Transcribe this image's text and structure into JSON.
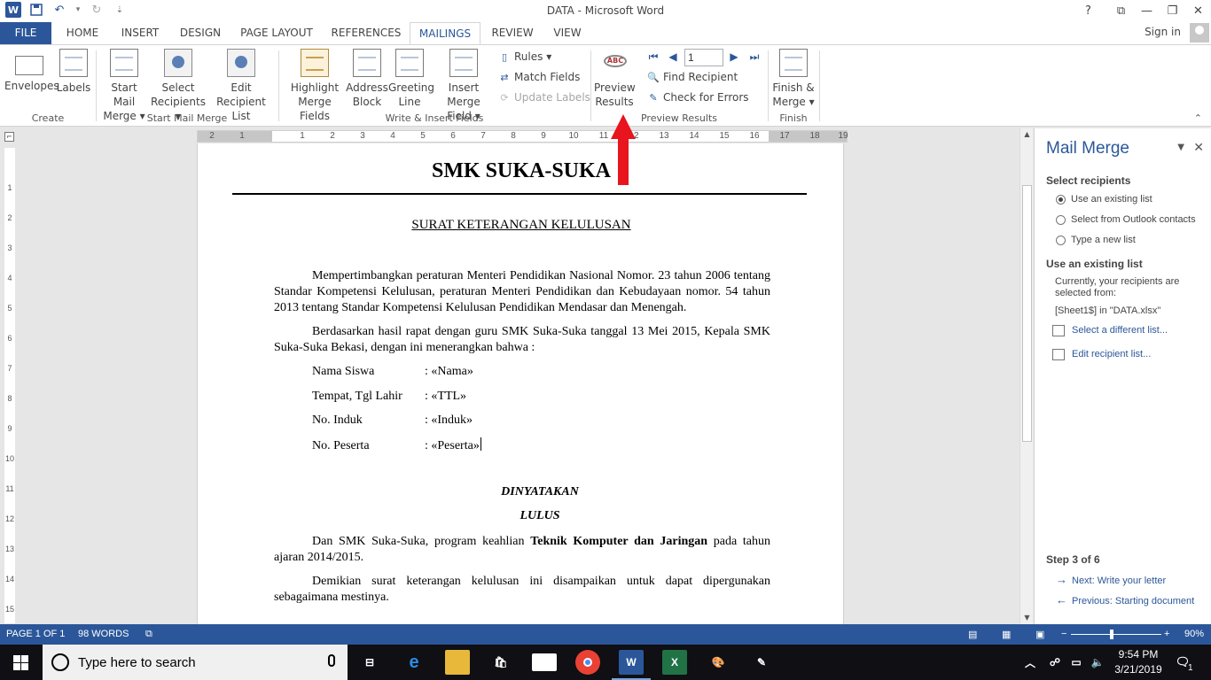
{
  "window": {
    "title": "DATA - Microsoft Word",
    "help": "?",
    "ribbon_opts": "⧉",
    "minimize": "—",
    "restore": "❐",
    "close": "✕"
  },
  "qat": {
    "app_icon": "W",
    "save_icon": "💾",
    "undo": "↶",
    "undo_drop": "▾",
    "redo": "↻",
    "customize": "⇣"
  },
  "tabs": [
    "FILE",
    "HOME",
    "INSERT",
    "DESIGN",
    "PAGE LAYOUT",
    "REFERENCES",
    "MAILINGS",
    "REVIEW",
    "VIEW"
  ],
  "active_tab": "MAILINGS",
  "signin": "Sign in",
  "ribbon": {
    "create": {
      "envelopes": "Envelopes",
      "labels": "Labels",
      "group": "Create"
    },
    "start": {
      "start_mail_merge_1": "Start Mail",
      "start_mail_merge_2": "Merge ▾",
      "select_recipients_1": "Select",
      "select_recipients_2": "Recipients ▾",
      "edit_list_1": "Edit",
      "edit_list_2": "Recipient List",
      "group": "Start Mail Merge"
    },
    "write": {
      "highlight_1": "Highlight",
      "highlight_2": "Merge Fields",
      "address_1": "Address",
      "address_2": "Block",
      "greeting_1": "Greeting",
      "greeting_2": "Line",
      "insert_field_1": "Insert Merge",
      "insert_field_2": "Field ▾",
      "rules": "Rules ▾",
      "match_fields": "Match Fields",
      "update_labels": "Update Labels",
      "group": "Write & Insert Fields"
    },
    "preview": {
      "preview_1": "Preview",
      "preview_2": "Results",
      "abc": "ABC",
      "record": "1",
      "find_recipient": "Find Recipient",
      "check_errors": "Check for Errors",
      "group": "Preview Results"
    },
    "finish": {
      "finish_1": "Finish &",
      "finish_2": "Merge ▾",
      "group": "Finish"
    }
  },
  "ruler_numbers": [
    "2",
    "1",
    "1",
    "2",
    "3",
    "4",
    "5",
    "6",
    "7",
    "8",
    "9",
    "10",
    "11",
    "12",
    "13",
    "14",
    "15",
    "16",
    "17",
    "18",
    "19"
  ],
  "vruler_numbers": [
    "1",
    "2",
    "3",
    "4",
    "5",
    "6",
    "7",
    "8",
    "9",
    "10",
    "11",
    "12",
    "13",
    "14",
    "15"
  ],
  "document": {
    "school": "SMK SUKA-SUKA",
    "heading": "SURAT KETERANGAN KELULUSAN",
    "para1": "Mempertimbangkan peraturan Menteri Pendidikan Nasional Nomor. 23 tahun 2006 tentang Standar Kompetensi Kelulusan, peraturan Menteri Pendidikan dan Kebudayaan nomor. 54 tahun 2013 tentang Standar Kompetensi Kelulusan Pendidikan Mendasar dan Menengah.",
    "para2": "Berdasarkan hasil rapat dengan guru SMK Suka-Suka tanggal 13 Mei 2015, Kepala SMK Suka-Suka Bekasi, dengan ini menerangkan bahwa :",
    "fields": [
      {
        "label": "Nama Siswa",
        "value": ": «Nama»"
      },
      {
        "label": "Tempat, Tgl Lahir",
        "value": ": «TTL»"
      },
      {
        "label": "No. Induk",
        "value": ": «Induk»"
      },
      {
        "label": "No. Peserta",
        "value": ": «Peserta»"
      }
    ],
    "declare": "DINYATAKAN",
    "result": "LULUS",
    "para3_pre": "Dan SMK Suka-Suka, program keahlian ",
    "para3_bold": "Teknik Komputer dan Jaringan",
    "para3_post": " pada tahun ajaran 2014/2015.",
    "para4": "Demikian surat keterangan kelulusan ini disampaikan untuk dapat dipergunakan sebagaimana mestinya."
  },
  "pane": {
    "title": "Mail Merge",
    "close": "✕",
    "drop": "▼",
    "select_recipients": "Select recipients",
    "options": [
      "Use an existing list",
      "Select from Outlook contacts",
      "Type a new list"
    ],
    "selected_option": 0,
    "existing_heading": "Use an existing list",
    "current_text": "Currently, your recipients are selected from:",
    "source": "[Sheet1$] in \"DATA.xlsx\"",
    "link_select": "Select a different list...",
    "link_edit": "Edit recipient list...",
    "step": "Step 3 of 6",
    "next": "Next: Write your letter",
    "previous": "Previous: Starting document"
  },
  "status": {
    "page": "PAGE 1 OF 1",
    "words": "98 WORDS",
    "zoom": "90%",
    "zoom_fraction": 0.45
  },
  "taskbar": {
    "search": "Type here to search",
    "time": "9:54 PM",
    "date": "3/21/2019",
    "notifications": "1"
  },
  "colors": {
    "word_blue": "#2b579a",
    "arrow_red": "#e8141e"
  }
}
